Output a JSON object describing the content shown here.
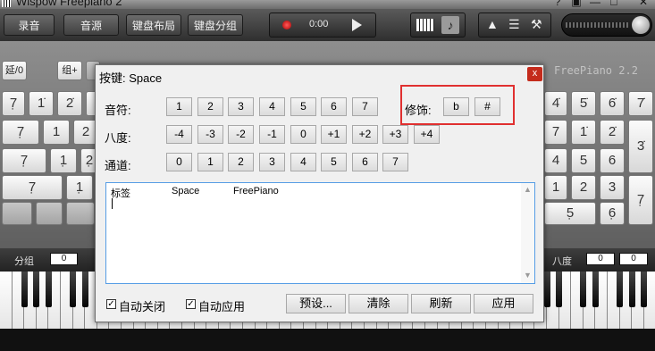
{
  "window": {
    "title": "Wispow Freepiano 2",
    "controls": [
      "?",
      "▣",
      "—",
      "□",
      "✕"
    ]
  },
  "toolbar": {
    "record": "录音",
    "sound_source": "音源",
    "keyboard_layout": "键盘布局",
    "keyboard_group": "键盘分组",
    "time": "0:00"
  },
  "keyboard": {
    "row0_keys": [
      "延/0",
      "组+"
    ],
    "brand": "FreePiano 2.2",
    "left_keys": [
      [
        "7̣",
        "1̇",
        "2̇"
      ],
      [
        "7̣",
        "1",
        "2"
      ],
      [
        "7̣",
        "1̣",
        "2̣"
      ],
      [
        "7̣",
        "1̣"
      ]
    ],
    "right_keys": [
      [
        "4̇",
        "5̇",
        "6̇",
        "7̇"
      ],
      [
        "7",
        "1̇",
        "2̇"
      ],
      [
        "4",
        "5",
        "6"
      ],
      [
        "1",
        "2",
        "3"
      ],
      [
        "5̣",
        "6̣"
      ],
      [
        "3̇",
        "7̣"
      ]
    ]
  },
  "bottombar": {
    "group_label": "分组",
    "group_value": "0",
    "octave_label": "八度",
    "octave_value_1": "0",
    "octave_value_2": "0"
  },
  "dialog": {
    "title": "按键:  Space",
    "close": "x",
    "note_label": "音符:",
    "note_buttons": [
      "1",
      "2",
      "3",
      "4",
      "5",
      "6",
      "7"
    ],
    "modifier_label": "修饰:",
    "modifier_buttons": [
      "b",
      "#"
    ],
    "octave_label": "八度:",
    "octave_buttons": [
      "-4",
      "-3",
      "-2",
      "-1",
      "0",
      "+1",
      "+2",
      "+3",
      "+4"
    ],
    "channel_label": "通道:",
    "channel_buttons": [
      "0",
      "1",
      "2",
      "3",
      "4",
      "5",
      "6",
      "7"
    ],
    "text_area": {
      "col1": "标签",
      "col2": "Space",
      "col3": "FreePiano"
    },
    "auto_close_label": "自动关闭",
    "auto_close_checked": true,
    "auto_apply_label": "自动应用",
    "auto_apply_checked": true,
    "preset_button": "预设...",
    "clear_button": "清除",
    "refresh_button": "刷新",
    "apply_button": "应用",
    "highlight_color": "#e03030",
    "close_color": "#c42b1c"
  }
}
